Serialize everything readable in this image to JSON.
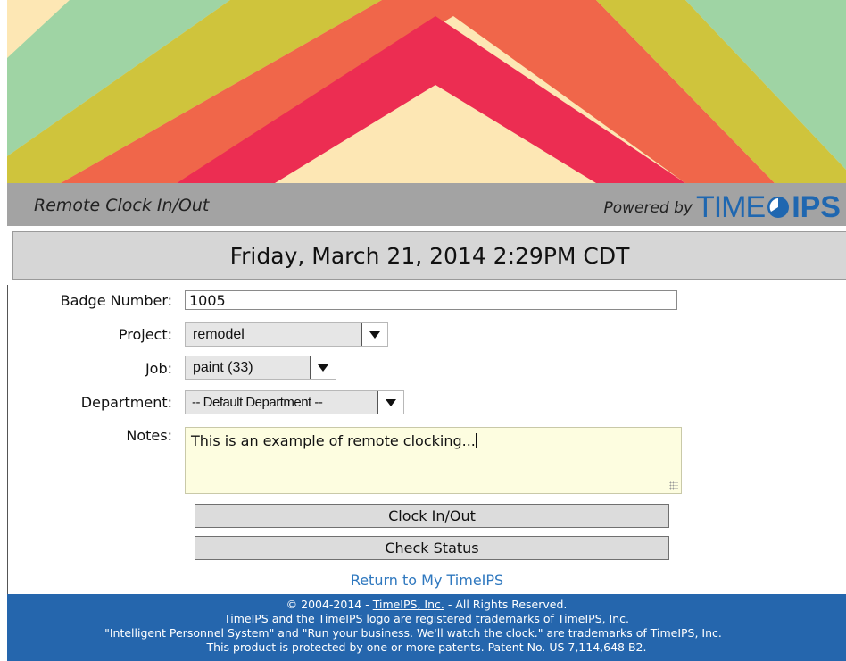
{
  "header": {
    "title": "Remote Clock In/Out",
    "powered_by": "Powered by",
    "brand_time": "TIME",
    "brand_ips": "IPS"
  },
  "datebar": {
    "text": "Friday, March 21, 2014 2:29PM CDT"
  },
  "form": {
    "badge_label": "Badge Number:",
    "badge_value": "1005",
    "project_label": "Project:",
    "project_value": "remodel",
    "job_label": "Job:",
    "job_value": "paint (33)",
    "department_label": "Department:",
    "department_value": "-- Default Department --",
    "notes_label": "Notes:",
    "notes_value": "This is an example of remote clocking...",
    "clock_button": "Clock In/Out",
    "status_button": "Check Status",
    "return_link": "Return to My TimeIPS"
  },
  "footer": {
    "line1_pre": "© 2004-2014 - ",
    "line1_link": "TimeIPS, Inc.",
    "line1_post": " - All Rights Reserved.",
    "line2": "TimeIPS and the TimeIPS logo are registered trademarks of TimeIPS, Inc.",
    "line3": "\"Intelligent Personnel System\" and \"Run your business. We'll watch the clock.\" are trademarks of TimeIPS, Inc.",
    "line4": "This product is protected by one or more patents. Patent No. US 7,114,648 B2."
  },
  "colors": {
    "banner_bg": "#fde7b4",
    "chevron_green": "#9fd4a4",
    "chevron_olive": "#cfc43c",
    "chevron_orange": "#f0664a",
    "chevron_red": "#ec2d52",
    "appbar": "#a3a3a3",
    "brand_blue": "#1f67b0",
    "footer_blue": "#2566ad",
    "link_blue": "#2f78bf"
  }
}
